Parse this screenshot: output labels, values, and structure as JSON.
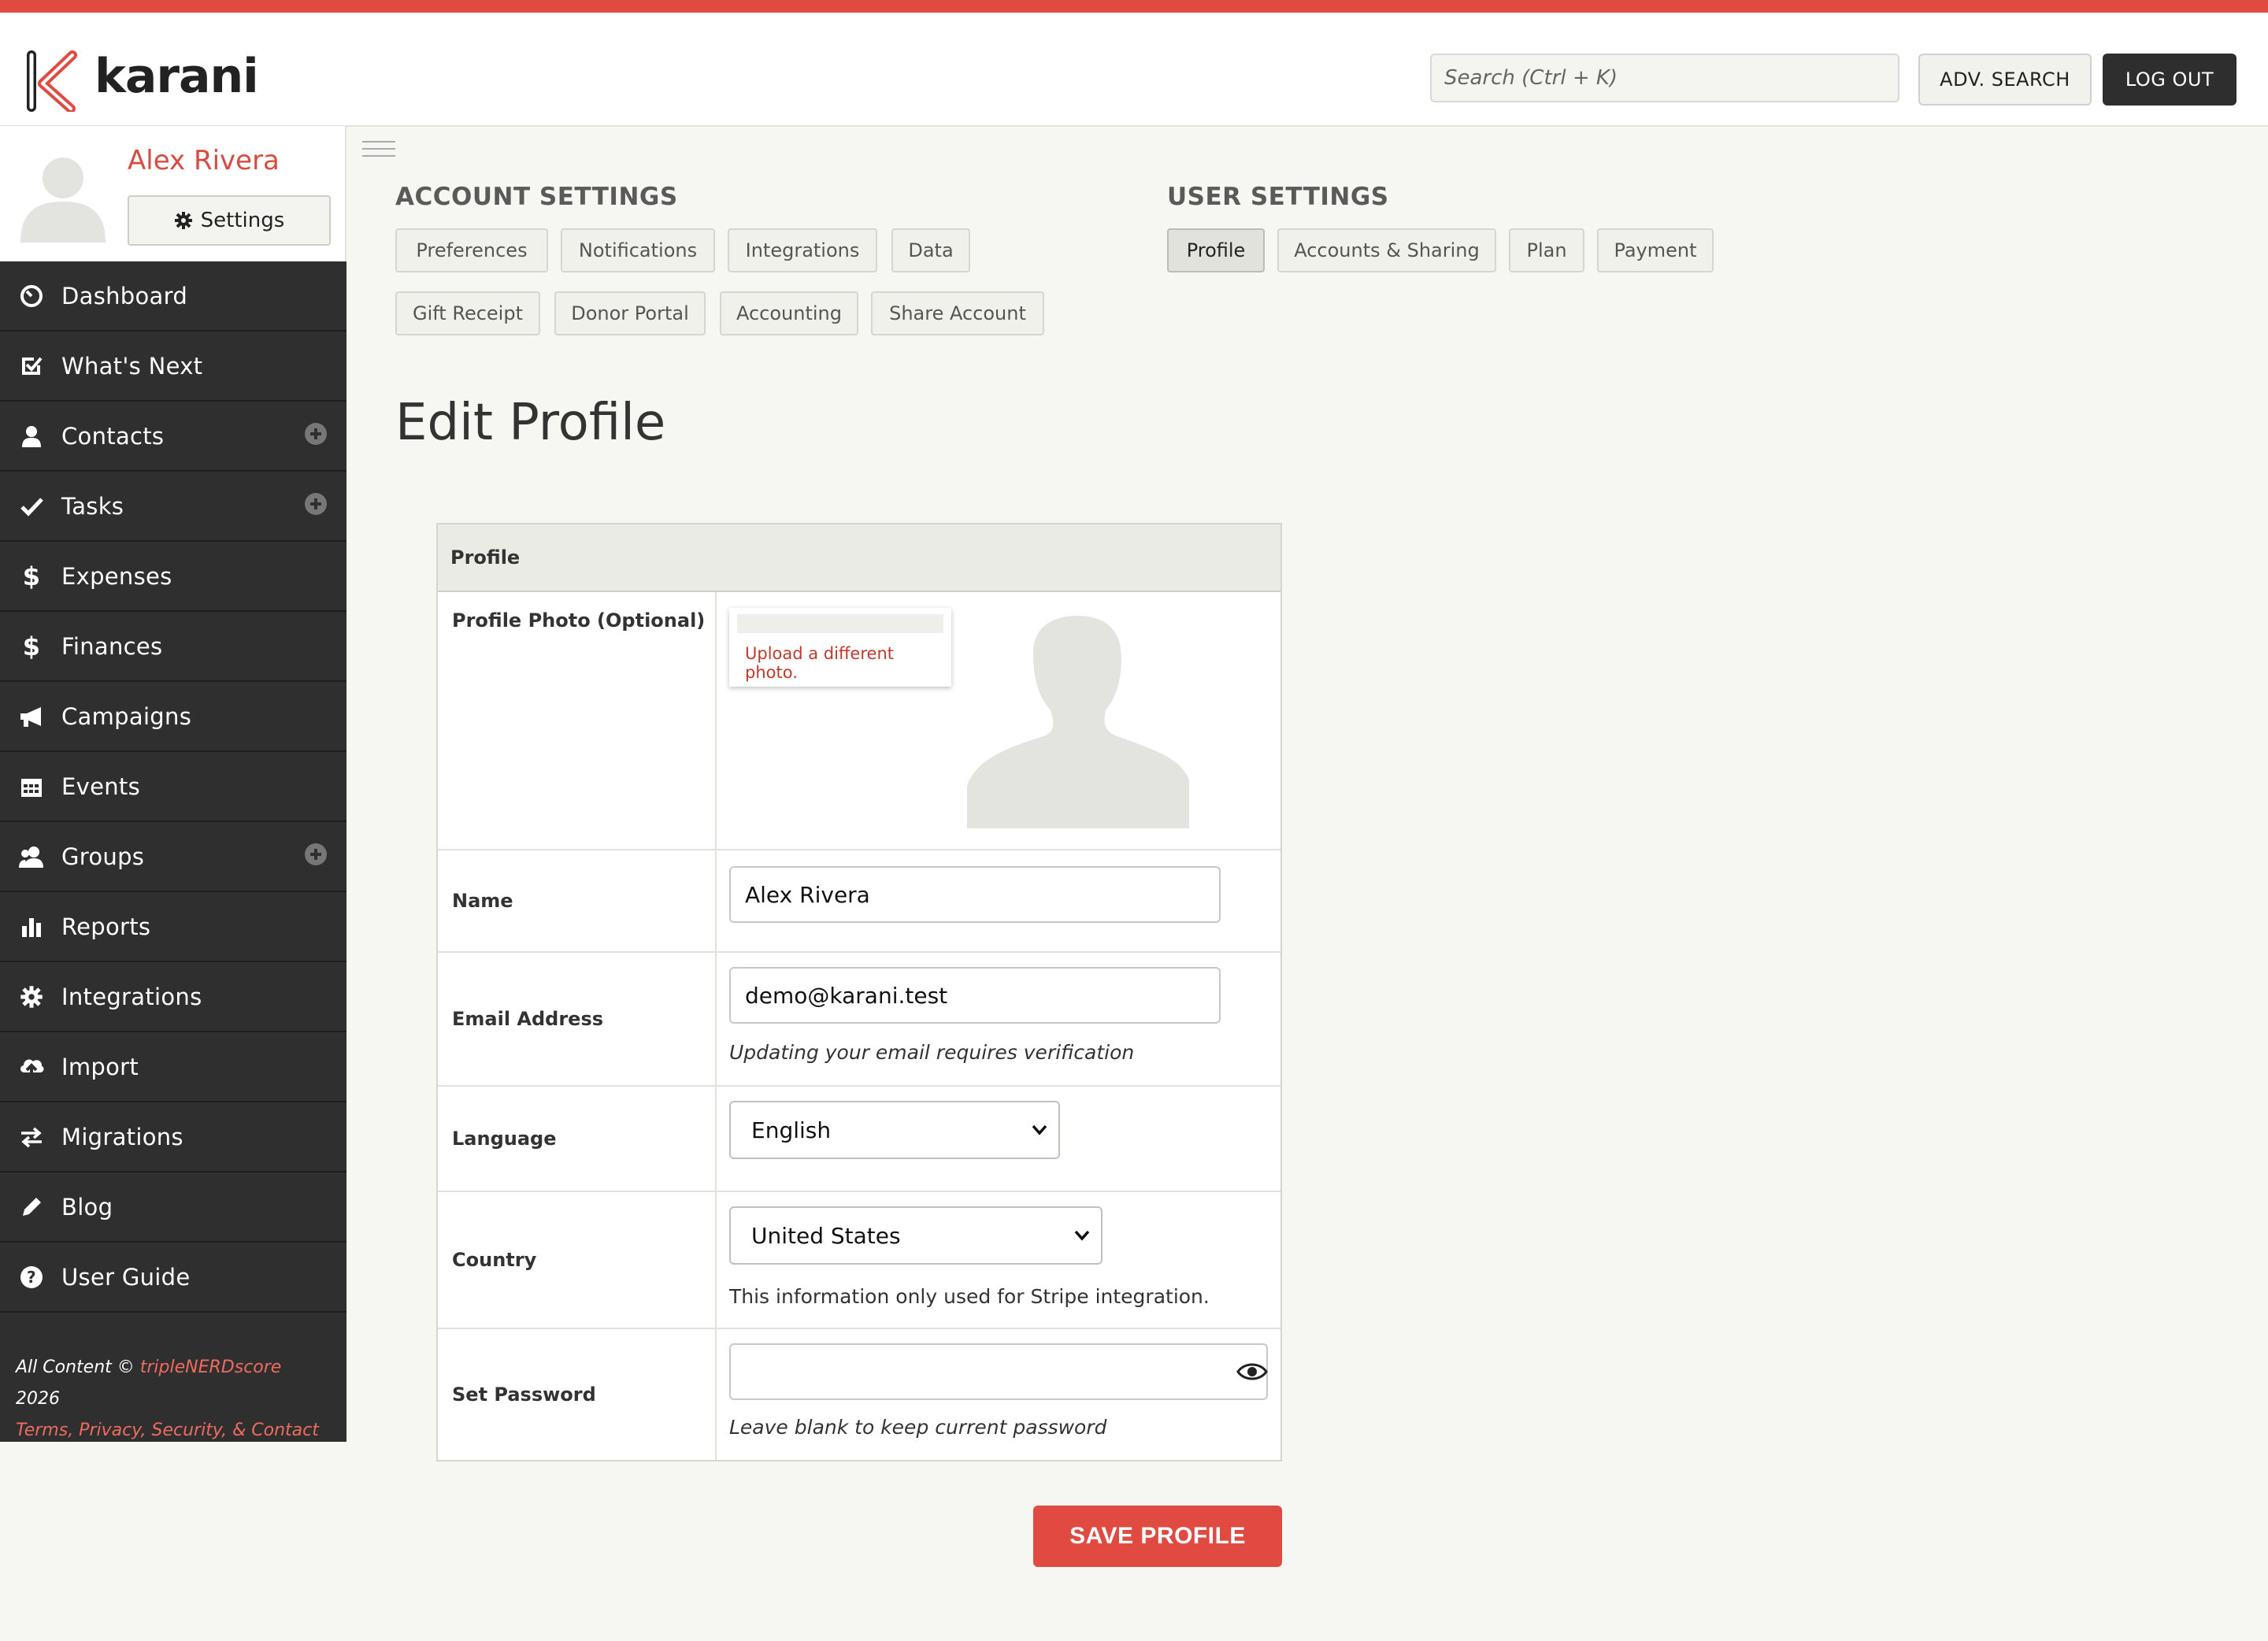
{
  "brand": {
    "name": "karani",
    "accent": "#e04a40",
    "dark": "#2f2f2f"
  },
  "header": {
    "search_placeholder": "Search (Ctrl + K)",
    "adv_search_label": "ADV. SEARCH",
    "logout_label": "LOG OUT"
  },
  "user": {
    "name": "Alex Rivera",
    "settings_label": "Settings"
  },
  "sidebar": {
    "items": [
      {
        "label": "Dashboard",
        "icon": "dashboard-icon",
        "has_add": false
      },
      {
        "label": "What's Next",
        "icon": "check-square-icon",
        "has_add": false
      },
      {
        "label": "Contacts",
        "icon": "person-icon",
        "has_add": true
      },
      {
        "label": "Tasks",
        "icon": "checkmark-icon",
        "has_add": true
      },
      {
        "label": "Expenses",
        "icon": "dollar-icon",
        "has_add": false
      },
      {
        "label": "Finances",
        "icon": "dollar-icon",
        "has_add": false
      },
      {
        "label": "Campaigns",
        "icon": "megaphone-icon",
        "has_add": false
      },
      {
        "label": "Events",
        "icon": "calendar-icon",
        "has_add": false
      },
      {
        "label": "Groups",
        "icon": "group-icon",
        "has_add": true
      },
      {
        "label": "Reports",
        "icon": "bar-chart-icon",
        "has_add": false
      },
      {
        "label": "Integrations",
        "icon": "gear-icon",
        "has_add": false
      },
      {
        "label": "Import",
        "icon": "cloud-upload-icon",
        "has_add": false
      },
      {
        "label": "Migrations",
        "icon": "exchange-icon",
        "has_add": false
      },
      {
        "label": "Blog",
        "icon": "pencil-icon",
        "has_add": false
      },
      {
        "label": "User Guide",
        "icon": "question-icon",
        "has_add": false
      }
    ],
    "footer": {
      "prefix": "All Content © ",
      "company": "tripleNERDscore",
      "year": " 2026",
      "links": "Terms, Privacy, Security, & Contact"
    }
  },
  "account_settings": {
    "title": "ACCOUNT SETTINGS",
    "tabs": [
      "Preferences",
      "Notifications",
      "Integrations",
      "Data",
      "Gift Receipt",
      "Donor Portal",
      "Accounting",
      "Share Account"
    ]
  },
  "user_settings": {
    "title": "USER SETTINGS",
    "tabs": [
      "Profile",
      "Accounts & Sharing",
      "Plan",
      "Payment"
    ],
    "active": "Profile"
  },
  "page_title": "Edit Profile",
  "profile_table": {
    "header": "Profile",
    "photo_label": "Profile Photo (Optional)",
    "upload_link": "Upload a different photo.",
    "name_label": "Name",
    "name_value": "Alex Rivera",
    "email_label": "Email Address",
    "email_value": "demo@karani.test",
    "email_help": "Updating your email requires verification",
    "language_label": "Language",
    "language_value": "English",
    "country_label": "Country",
    "country_value": "United States",
    "country_help": "This information only used for Stripe integration.",
    "password_label": "Set Password",
    "password_value": "",
    "password_help": "Leave blank to keep current password"
  },
  "save_label": "SAVE PROFILE"
}
